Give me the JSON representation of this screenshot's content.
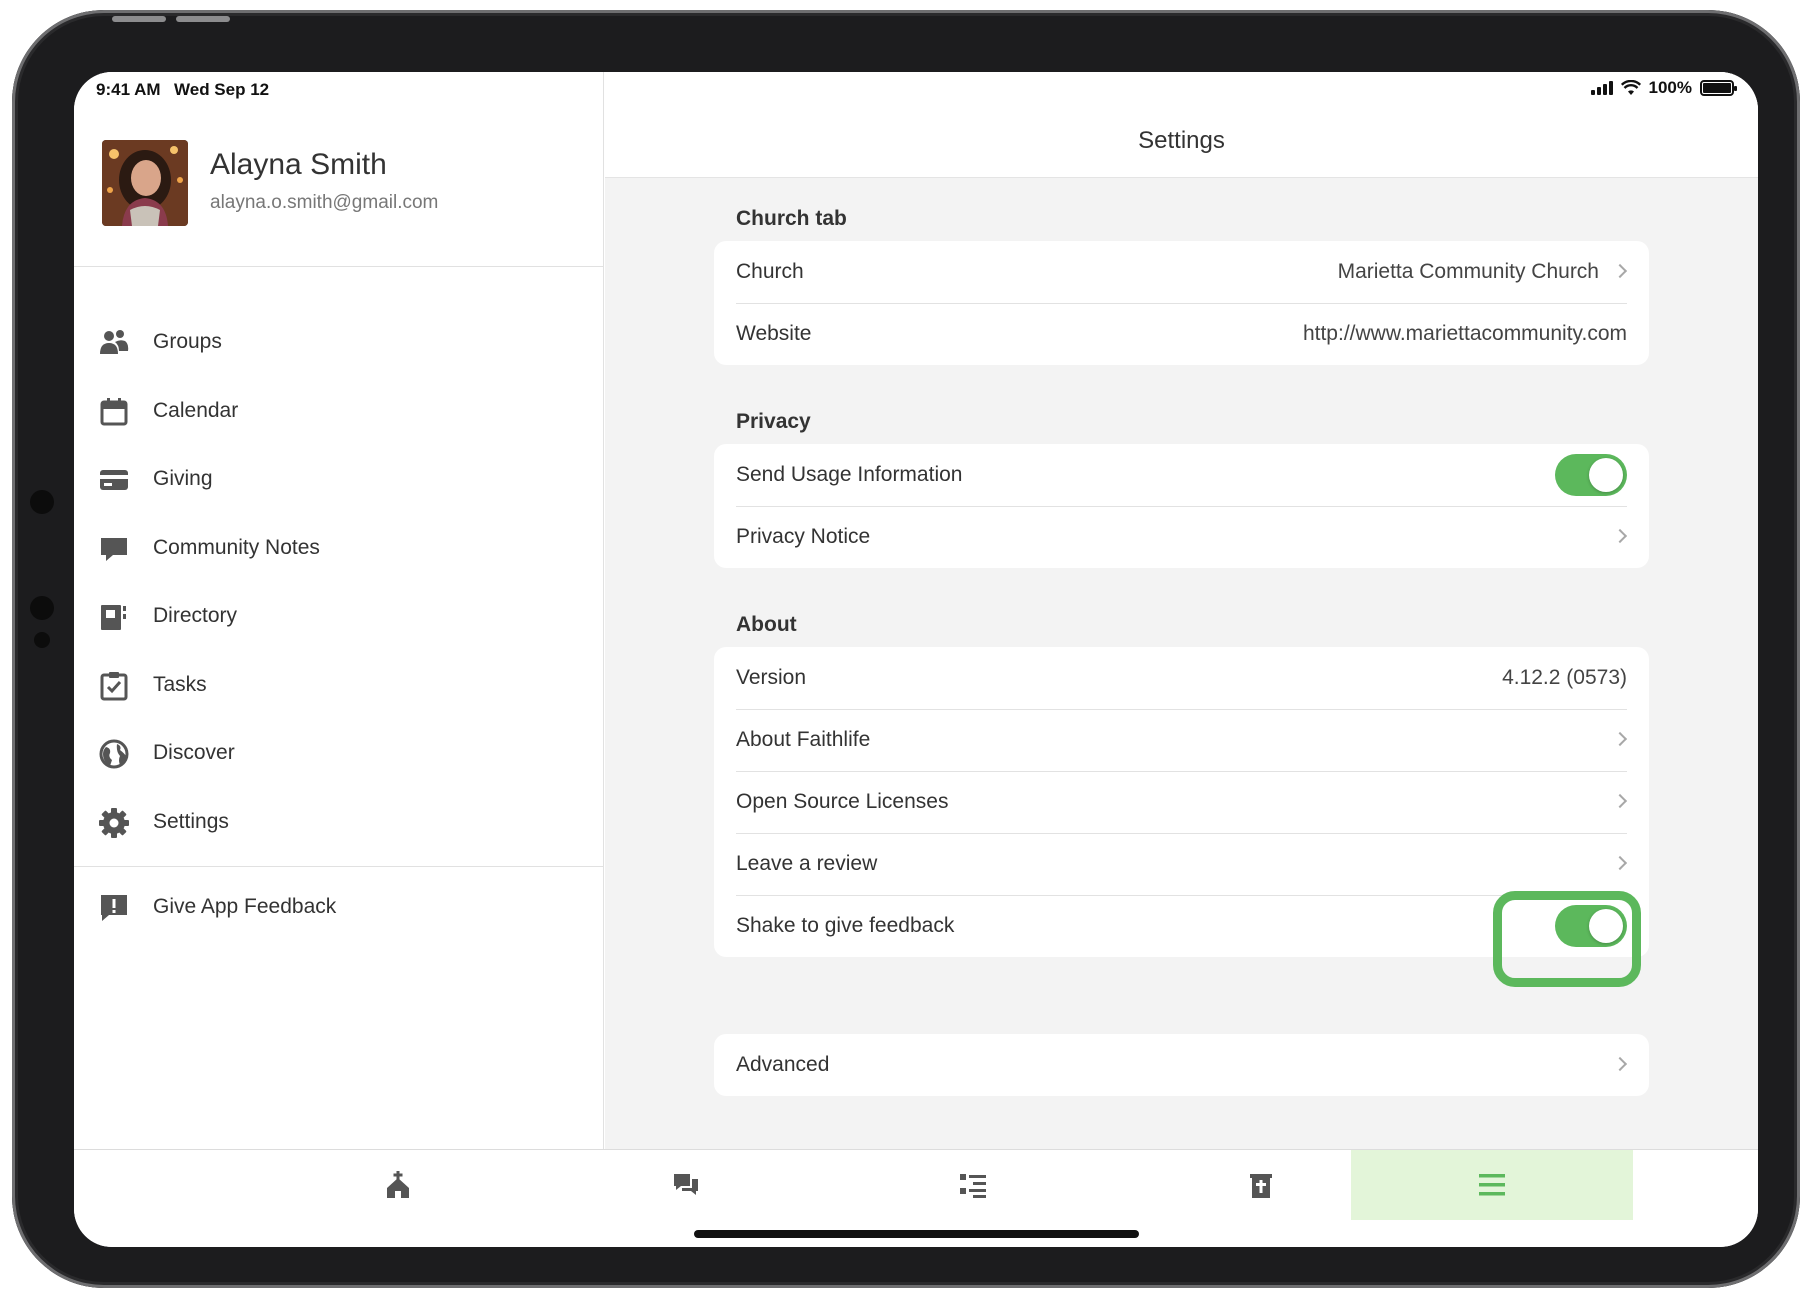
{
  "status_bar": {
    "time": "9:41 AM",
    "date": "Wed Sep 12",
    "battery": "100%"
  },
  "profile": {
    "name": "Alayna Smith",
    "email": "alayna.o.smith@gmail.com"
  },
  "sidebar": {
    "items": [
      {
        "label": "Groups",
        "icon": "groups-icon"
      },
      {
        "label": "Calendar",
        "icon": "calendar-icon"
      },
      {
        "label": "Giving",
        "icon": "credit-card-icon"
      },
      {
        "label": "Community Notes",
        "icon": "comment-icon"
      },
      {
        "label": "Directory",
        "icon": "directory-icon"
      },
      {
        "label": "Tasks",
        "icon": "clipboard-check-icon"
      },
      {
        "label": "Discover",
        "icon": "globe-icon"
      },
      {
        "label": "Settings",
        "icon": "gear-icon"
      }
    ],
    "feedback": {
      "label": "Give App Feedback",
      "icon": "feedback-icon"
    }
  },
  "settings": {
    "title": "Settings",
    "church_tab": {
      "header": "Church tab",
      "church_label": "Church",
      "church_value": "Marietta Community Church",
      "website_label": "Website",
      "website_value": "http://www.mariettacommunity.com"
    },
    "privacy": {
      "header": "Privacy",
      "usage_label": "Send Usage Information",
      "usage_on": true,
      "notice_label": "Privacy Notice"
    },
    "about": {
      "header": "About",
      "version_label": "Version",
      "version_value": "4.12.2 (0573)",
      "about_label": "About Faithlife",
      "licenses_label": "Open Source Licenses",
      "review_label": "Leave a review",
      "shake_label": "Shake to give feedback",
      "shake_on": true
    },
    "advanced_label": "Advanced"
  },
  "tabbar": {
    "tabs": [
      {
        "icon": "church-icon"
      },
      {
        "icon": "chat-icon"
      },
      {
        "icon": "list-icon"
      },
      {
        "icon": "bible-icon"
      },
      {
        "icon": "menu-icon",
        "active": true
      }
    ]
  },
  "colors": {
    "accent": "#5cb85c",
    "active_tab_bg": "#e3f5d9",
    "background": "#f3f3f3"
  }
}
